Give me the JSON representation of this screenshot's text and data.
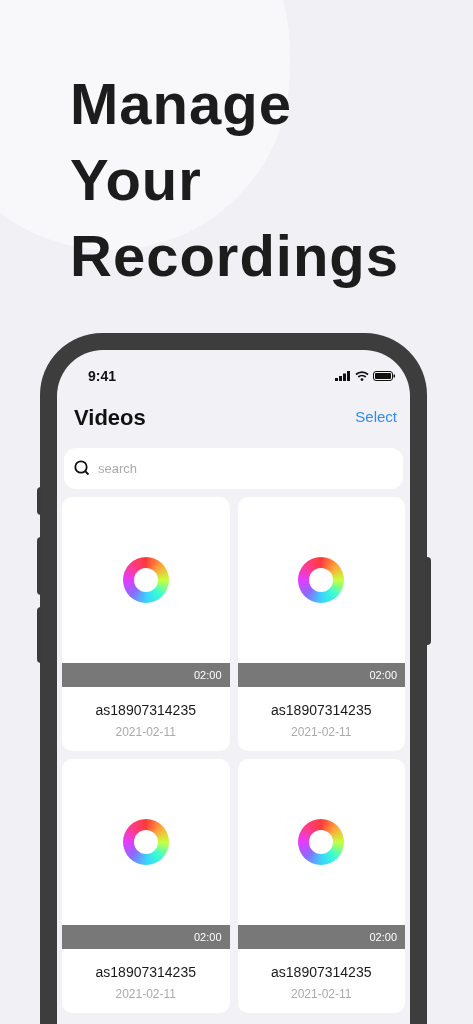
{
  "headline": [
    "Manage",
    "Your",
    "Recordings"
  ],
  "status_bar": {
    "time": "9:41"
  },
  "nav": {
    "title": "Videos",
    "action": "Select"
  },
  "search": {
    "placeholder": "search"
  },
  "videos": [
    {
      "duration": "02:00",
      "name": "as18907314235",
      "date": "2021-02-11"
    },
    {
      "duration": "02:00",
      "name": "as18907314235",
      "date": "2021-02-11"
    },
    {
      "duration": "02:00",
      "name": "as18907314235",
      "date": "2021-02-11"
    },
    {
      "duration": "02:00",
      "name": "as18907314235",
      "date": "2021-02-11"
    }
  ]
}
